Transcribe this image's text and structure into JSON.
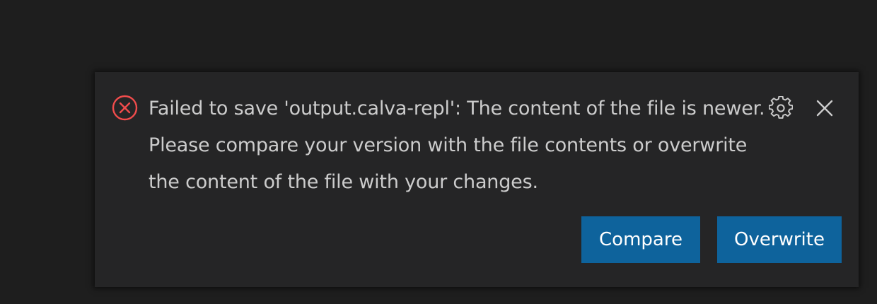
{
  "notification": {
    "severity_icon": "error-circle-x-icon",
    "message": "Failed to save 'output.calva-repl': The content of the file is newer. Please compare your version with the file contents or overwrite the content of the file with your changes.",
    "actions": [
      {
        "label": "Compare"
      },
      {
        "label": "Overwrite"
      }
    ],
    "toolbar": {
      "settings_icon": "gear-icon",
      "close_icon": "close-icon"
    }
  },
  "colors": {
    "background": "#1e1e1e",
    "toast_background": "#252526",
    "error": "#f14c4c",
    "text": "#cccccc",
    "button": "#0e639c",
    "button_text": "#ffffff"
  }
}
